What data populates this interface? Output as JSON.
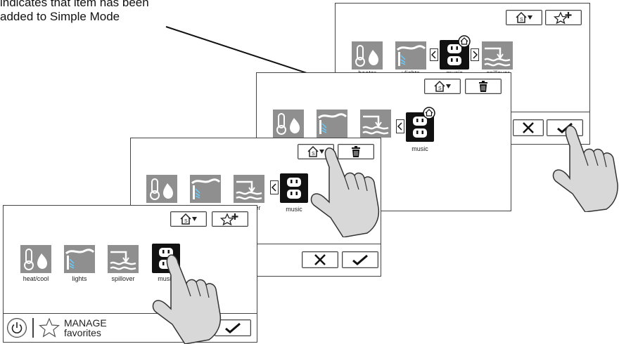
{
  "caption": {
    "line1": "indicates that item has been",
    "line2": "added to Simple Mode"
  },
  "tile_labels": {
    "heater": "heater",
    "lights": "lights",
    "music": "music",
    "spillover": "spillover",
    "heat_cool": "heat/cool"
  },
  "screen4": {
    "labels_visible": [
      "heater",
      "vlights",
      "music",
      "spillover"
    ]
  },
  "front": {
    "manage_line1": "MANAGE",
    "manage_line2": "favorites"
  },
  "icons": {
    "simple_mode": "house-S-arrow-icon",
    "add_favorite": "star-plus-icon",
    "delete": "trash-icon",
    "cancel": "x-icon",
    "confirm": "check-icon",
    "power": "power-icon",
    "star": "star-outline-icon"
  }
}
